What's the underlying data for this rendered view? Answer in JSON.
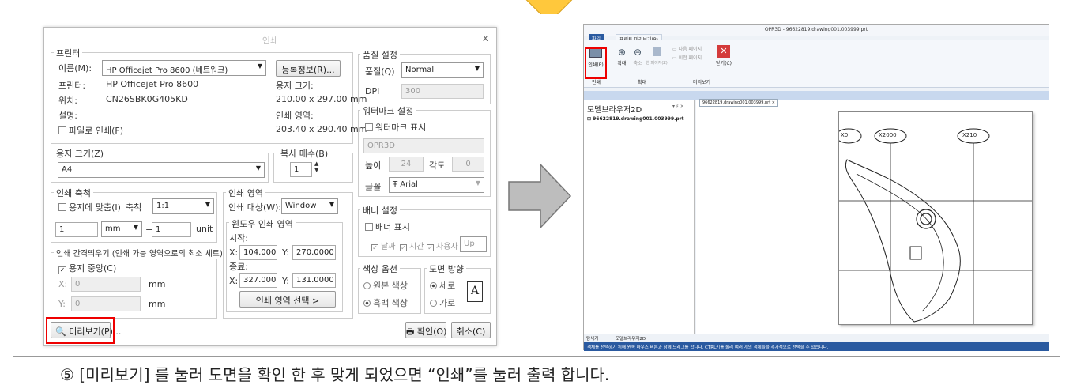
{
  "dialog": {
    "title": "인쇄",
    "close": "x",
    "printer": {
      "group": "프린터",
      "name_label": "이름(M):",
      "name_value": "HP Officejet Pro 8600 (네트워크)",
      "props_button": "등록정보(R)...",
      "printer_label": "프린터:",
      "printer_value": "HP Officejet Pro 8600",
      "location_label": "위치:",
      "location_value": "CN26SBK0G405KD",
      "desc_label": "설명:",
      "paper_size_label": "용지 크기:",
      "paper_size_value": "210.00 x 297.00 mm",
      "print_area_label": "인쇄 영역:",
      "print_area_value": "203.40 x 290.40 mm",
      "print_to_file": "파일로 인쇄(F)"
    },
    "paper": {
      "group": "용지 크기(Z)",
      "value": "A4"
    },
    "copies": {
      "group": "복사 매수(B)",
      "value": "1"
    },
    "scale": {
      "group": "인쇄 축척",
      "fit": "용지에 맞춤(I)",
      "scale_label": "축척",
      "scale_value": "1:1",
      "left_value": "1",
      "unit_value": "mm",
      "eq": "=",
      "right_value": "1",
      "unit_label": "unit"
    },
    "margin": {
      "group": "인쇄 간격띄우기 (인쇄 가능 영역으로의 최소 세트)",
      "center": "용지 중앙(C)",
      "x_label": "X:",
      "x_value": "0",
      "y_label": "Y:",
      "y_value": "0",
      "mm1": "mm",
      "mm2": "mm"
    },
    "area": {
      "group": "인쇄 영역",
      "target_label": "인쇄 대상(W):",
      "target_value": "Window",
      "window_group": "윈도우 인쇄 영역",
      "start_label": "시작:",
      "x_label": "X:",
      "y_label": "Y:",
      "sx": "104.0000",
      "sy": "270.0000",
      "end_label": "종료:",
      "ex": "327.0000",
      "ey": "131.0000",
      "select_button": "인쇄 영역 선택 >"
    },
    "quality": {
      "group": "품질 설정",
      "quality_label": "품질(Q)",
      "quality_value": "Normal",
      "dpi_label": "DPI",
      "dpi_value": "300"
    },
    "watermark": {
      "group": "워터마크 설정",
      "show": "워터마크 표시",
      "text": "OPR3D",
      "height_label": "높이",
      "height_value": "24",
      "angle_label": "각도",
      "angle_value": "0",
      "font_label": "글꼴",
      "font_value": "Arial"
    },
    "banner": {
      "group": "배너 설정",
      "show": "배너 표시",
      "date": "날짜",
      "time": "시간",
      "user": "사용자",
      "pos": "Up"
    },
    "color": {
      "group": "색상 옵션",
      "original": "원본 색상",
      "bw": "흑백 색상"
    },
    "orient": {
      "group": "도면 방향",
      "portrait": "세로",
      "landscape": "가로",
      "icon": "A"
    },
    "preview_button": "미리보기(P)...",
    "ok_button": "확인(O)",
    "cancel_button": "취소(C)"
  },
  "app": {
    "title": "OPR3D - 96622819.drawing001.003999.prt",
    "tabs": [
      "파일",
      "프린트 미리보기(P)"
    ],
    "ribbon": {
      "print": "인쇄(P)",
      "zoom_in": "확대",
      "zoom_out": "축소",
      "fit": "한 페이지(Z)",
      "next": "다음 페이지",
      "prev": "이전 페이지",
      "close": "닫기(C)",
      "group_print": "인쇄",
      "group_zoom": "확대",
      "group_preview": "미리보기"
    },
    "panel_title": "모델브라우저2D",
    "panel_pin": "▾ ♯ ×",
    "tree_item": "96622819.drawing001.003999.prt",
    "doc_tab": "96622819.drawing001.003999.prt",
    "labels": [
      "X0",
      "X2000",
      "X210"
    ],
    "bottom_tabs": [
      "탐색기",
      "모델브라우저2D"
    ],
    "status": "객체를 선택하기 위해 윈쪽 마우스 버튼과 함께 드래그를 합니다. CTRL키를 눌러 여러 개의 객체들을 추가적으로 선택할 수 있습니다."
  },
  "caption": "⑤ [미리보기] 를 눌러 도면을 확인 한 후 맞게 되었으면 “인쇄”를 눌러 출력 합니다.",
  "colors": {
    "highlight": "#e00000",
    "arrow": "#bdbdbd",
    "accent": "#ffc83c"
  }
}
